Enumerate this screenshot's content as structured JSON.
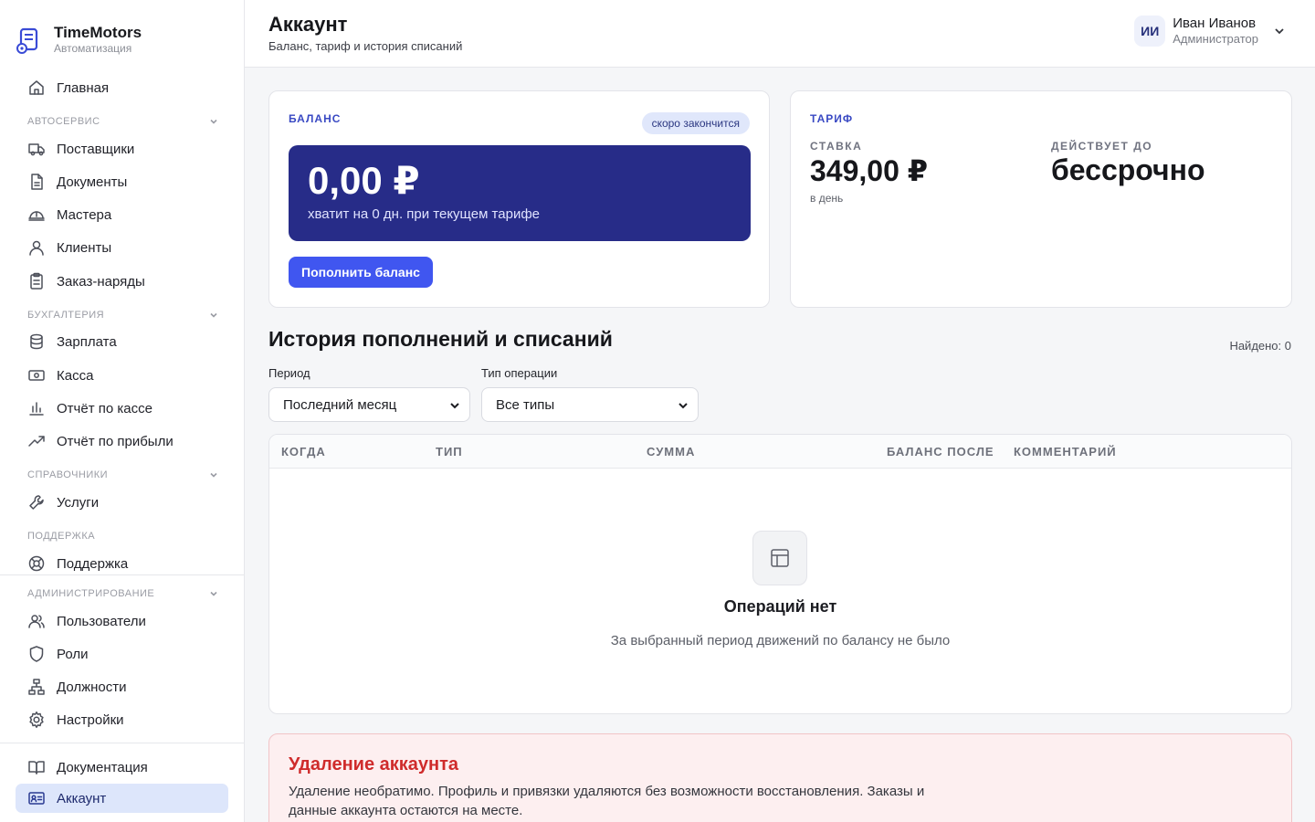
{
  "brand": {
    "name": "TimeMotors",
    "subtitle": "Автоматизация"
  },
  "sidebar": {
    "home": "Главная",
    "sections": {
      "autoservice": "Автосервис",
      "accounting": "Бухгалтерия",
      "references": "Справочники",
      "support": "Поддержка",
      "admin": "Администрирование"
    },
    "items": {
      "suppliers": "Поставщики",
      "documents": "Документы",
      "masters": "Мастера",
      "clients": "Клиенты",
      "orders": "Заказ-наряды",
      "salary": "Зарплата",
      "cash": "Касса",
      "cash_report": "Отчёт по кассе",
      "profit_report": "Отчёт по прибыли",
      "services": "Услуги",
      "support": "Поддержка",
      "users": "Пользователи",
      "roles": "Роли",
      "positions": "Должности",
      "settings": "Настройки",
      "docs": "Документация",
      "account": "Аккаунт"
    }
  },
  "header": {
    "title": "Аккаунт",
    "subtitle": "Баланс, тариф и история списаний",
    "user": {
      "initials": "ИИ",
      "name": "Иван Иванов",
      "role": "Администратор"
    }
  },
  "balance": {
    "label": "БАЛАНС",
    "badge": "скоро закончится",
    "amount": "0,00 ₽",
    "note": "хватит на 0 дн. при текущем тарифе",
    "topup_button": "Пополнить баланс"
  },
  "tariff": {
    "label": "ТАРИФ",
    "rate_label": "СТАВКА",
    "rate_value": "349,00 ₽",
    "rate_period": "в день",
    "valid_label": "ДЕЙСТВУЕТ ДО",
    "valid_value": "бессрочно"
  },
  "history": {
    "title": "История пополнений и списаний",
    "found": "Найдено: 0",
    "period_label": "Период",
    "period_value": "Последний месяц",
    "type_label": "Тип операции",
    "type_value": "Все типы",
    "columns": [
      "КОГДА",
      "ТИП",
      "СУММА",
      "БАЛАНС ПОСЛЕ",
      "КОММЕНТАРИЙ"
    ],
    "empty_title": "Операций нет",
    "empty_text": "За выбранный период движений по балансу не было"
  },
  "danger": {
    "title": "Удаление аккаунта",
    "text": "Удаление необратимо. Профиль и привязки удаляются без возможности восстановления. Заказы и данные аккаунта остаются на месте."
  },
  "colors": {
    "accent": "#4056f0",
    "balance_panel": "#272c88",
    "active_nav": "#dde6fb",
    "danger": "#cf2b2b",
    "danger_bg": "#fdeff0"
  }
}
